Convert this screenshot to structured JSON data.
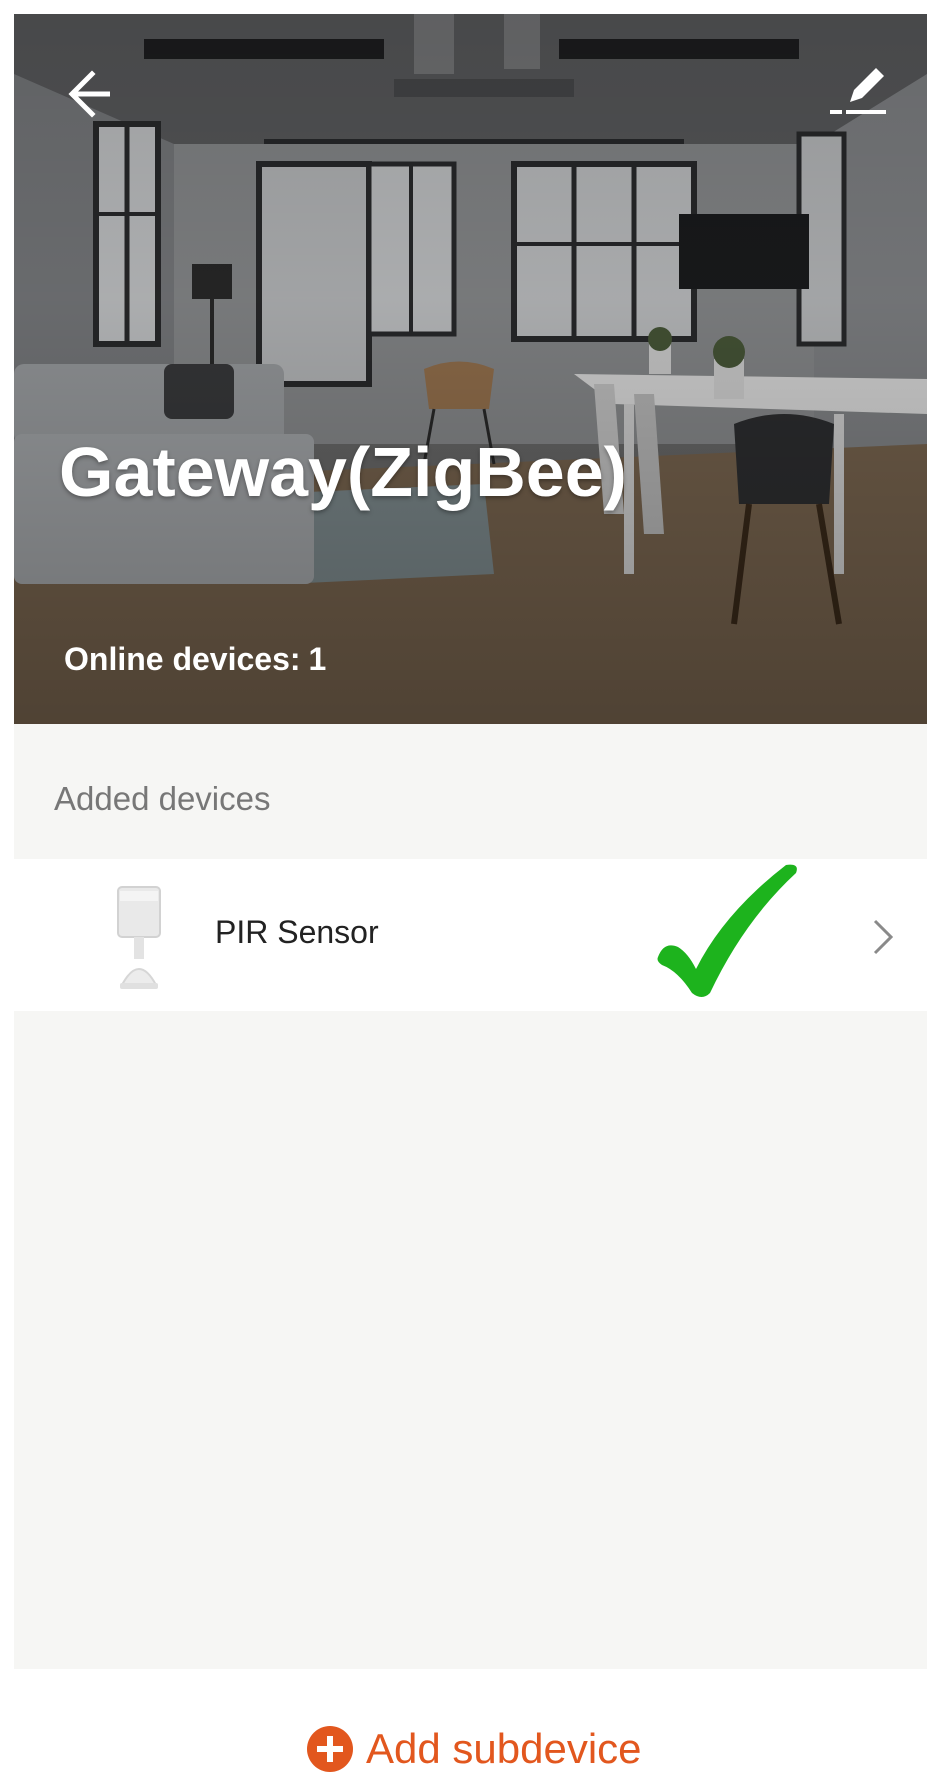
{
  "header": {
    "title": "Gateway(ZigBee)",
    "online_label": "Online devices:",
    "online_count": "1",
    "back_icon": "arrow-left-icon",
    "edit_icon": "pencil-icon"
  },
  "devices_section": {
    "label": "Added devices",
    "items": [
      {
        "name": "PIR Sensor",
        "icon": "pir-sensor-icon",
        "status_icon": "check-mark-icon",
        "chevron_icon": "chevron-right-icon"
      }
    ]
  },
  "footer": {
    "add_label": "Add subdevice",
    "add_icon": "plus-circle-icon"
  },
  "colors": {
    "accent": "#e2571e",
    "check_green": "#1db31d",
    "background": "#f6f6f4",
    "label_gray": "#777777"
  }
}
